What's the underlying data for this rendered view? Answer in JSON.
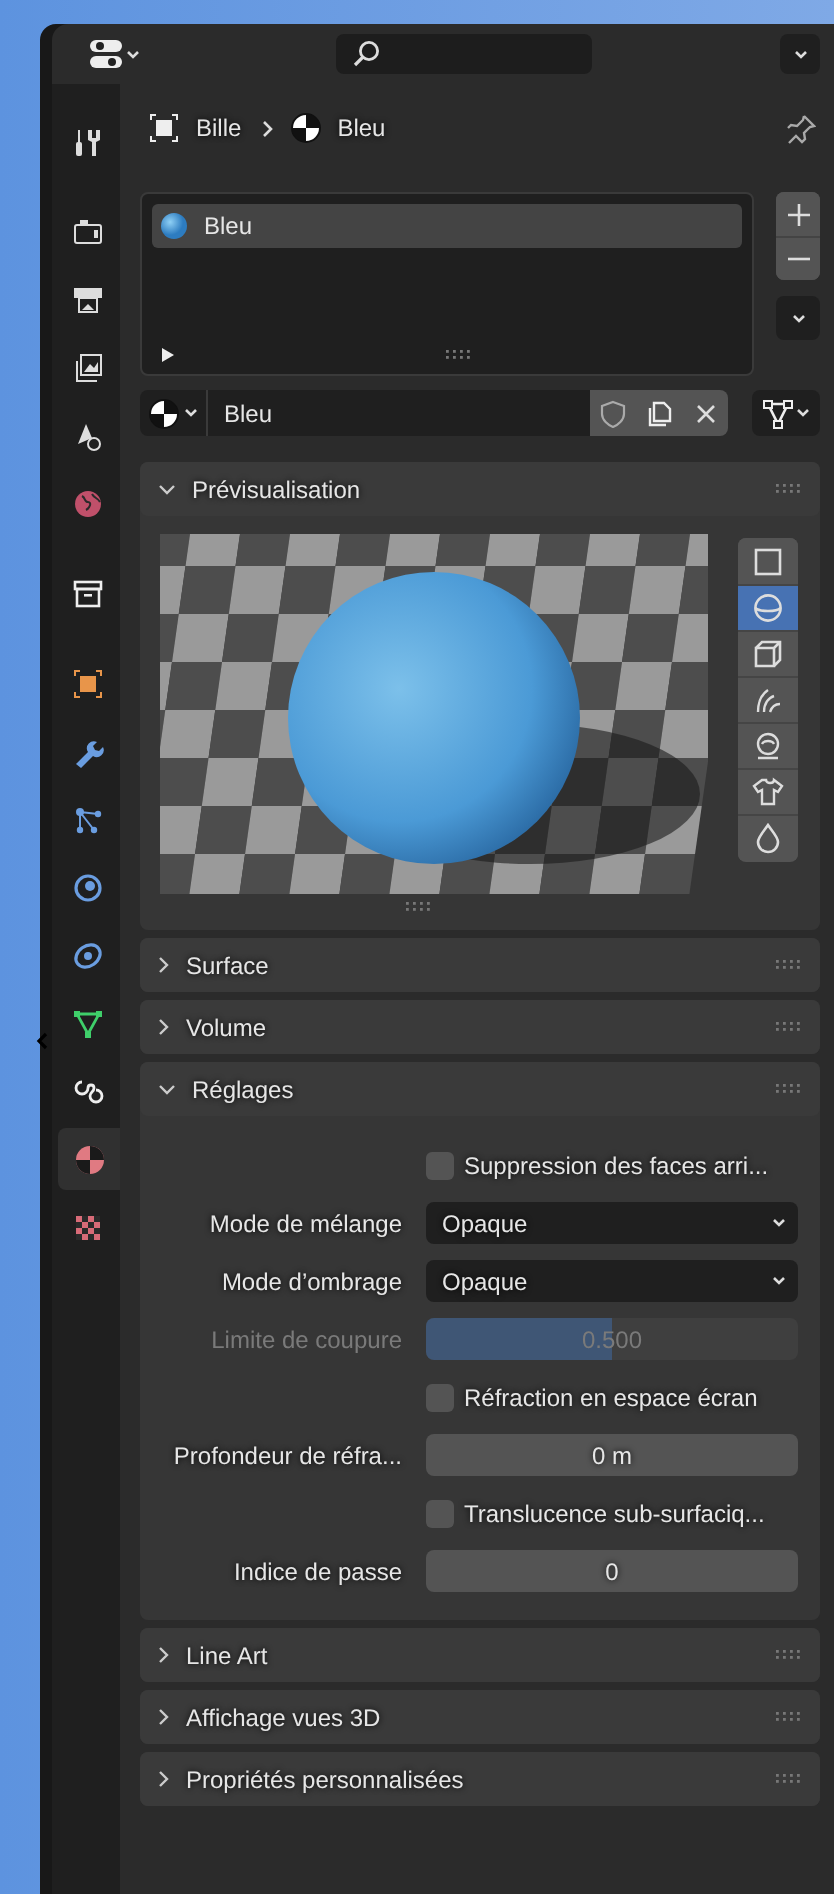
{
  "tab_groups": [
    [
      {
        "kind": "tool",
        "selected": false
      }
    ],
    [
      {
        "kind": "render",
        "selected": false
      },
      {
        "kind": "output",
        "selected": false
      },
      {
        "kind": "view_layer",
        "selected": false
      },
      {
        "kind": "scene",
        "selected": false
      },
      {
        "kind": "world",
        "selected": false
      }
    ],
    [
      {
        "kind": "collection",
        "selected": false
      }
    ],
    [
      {
        "kind": "object",
        "selected": false
      },
      {
        "kind": "modifier",
        "selected": false
      },
      {
        "kind": "particles",
        "selected": false
      },
      {
        "kind": "physics",
        "selected": false
      },
      {
        "kind": "constraint",
        "selected": false
      },
      {
        "kind": "data",
        "selected": false
      },
      {
        "kind": "swirl",
        "selected": false
      },
      {
        "kind": "material",
        "selected": true
      },
      {
        "kind": "texture",
        "selected": false
      }
    ]
  ],
  "breadcrumb": [
    {
      "kind": "object",
      "label": "Bille"
    },
    {
      "kind": "material",
      "label": "Bleu"
    }
  ],
  "slots": [
    {
      "label": "Bleu",
      "selected": true
    }
  ],
  "material_field": {
    "value": "Bleu"
  },
  "panels": [
    {
      "title": "Prévisualisation",
      "expanded": true,
      "kind": "preview",
      "shapes": [
        {
          "kind": "flat",
          "selected": false
        },
        {
          "kind": "sphere",
          "selected": true
        },
        {
          "kind": "cube",
          "selected": false
        },
        {
          "kind": "hair",
          "selected": false
        },
        {
          "kind": "monkey",
          "selected": false
        },
        {
          "kind": "cloth",
          "selected": false
        },
        {
          "kind": "fluid",
          "selected": false
        }
      ]
    },
    {
      "title": "Surface",
      "expanded": false
    },
    {
      "title": "Volume",
      "expanded": false
    },
    {
      "title": "Réglages",
      "expanded": true,
      "kind": "settings",
      "rows": [
        {
          "kind": "checkbox",
          "label": "Suppression des faces arri...",
          "checked": false,
          "disabled": false
        },
        {
          "kind": "dropdown",
          "label": "Mode de mélange",
          "value": "Opaque",
          "disabled": false
        },
        {
          "kind": "dropdown",
          "label": "Mode d’ombrage",
          "value": "Opaque",
          "disabled": false
        },
        {
          "kind": "slider",
          "label": "Limite de coupure",
          "value": "0.500",
          "level": 0.5,
          "disabled": true
        },
        {
          "kind": "checkbox",
          "label": "Réfraction en espace écran",
          "checked": false,
          "disabled": false
        },
        {
          "kind": "number",
          "label": "Profondeur de réfra...",
          "value": "0 m",
          "disabled": false
        },
        {
          "kind": "checkbox",
          "label": "Translucence sub-surfaciq...",
          "checked": false,
          "disabled": false
        },
        {
          "kind": "number",
          "label": "Indice de passe",
          "value": "0",
          "disabled": false
        }
      ]
    },
    {
      "title": "Line Art",
      "expanded": false
    },
    {
      "title": "Affichage vues 3D",
      "expanded": false
    },
    {
      "title": "Propriétés personnalisées",
      "expanded": false
    }
  ]
}
